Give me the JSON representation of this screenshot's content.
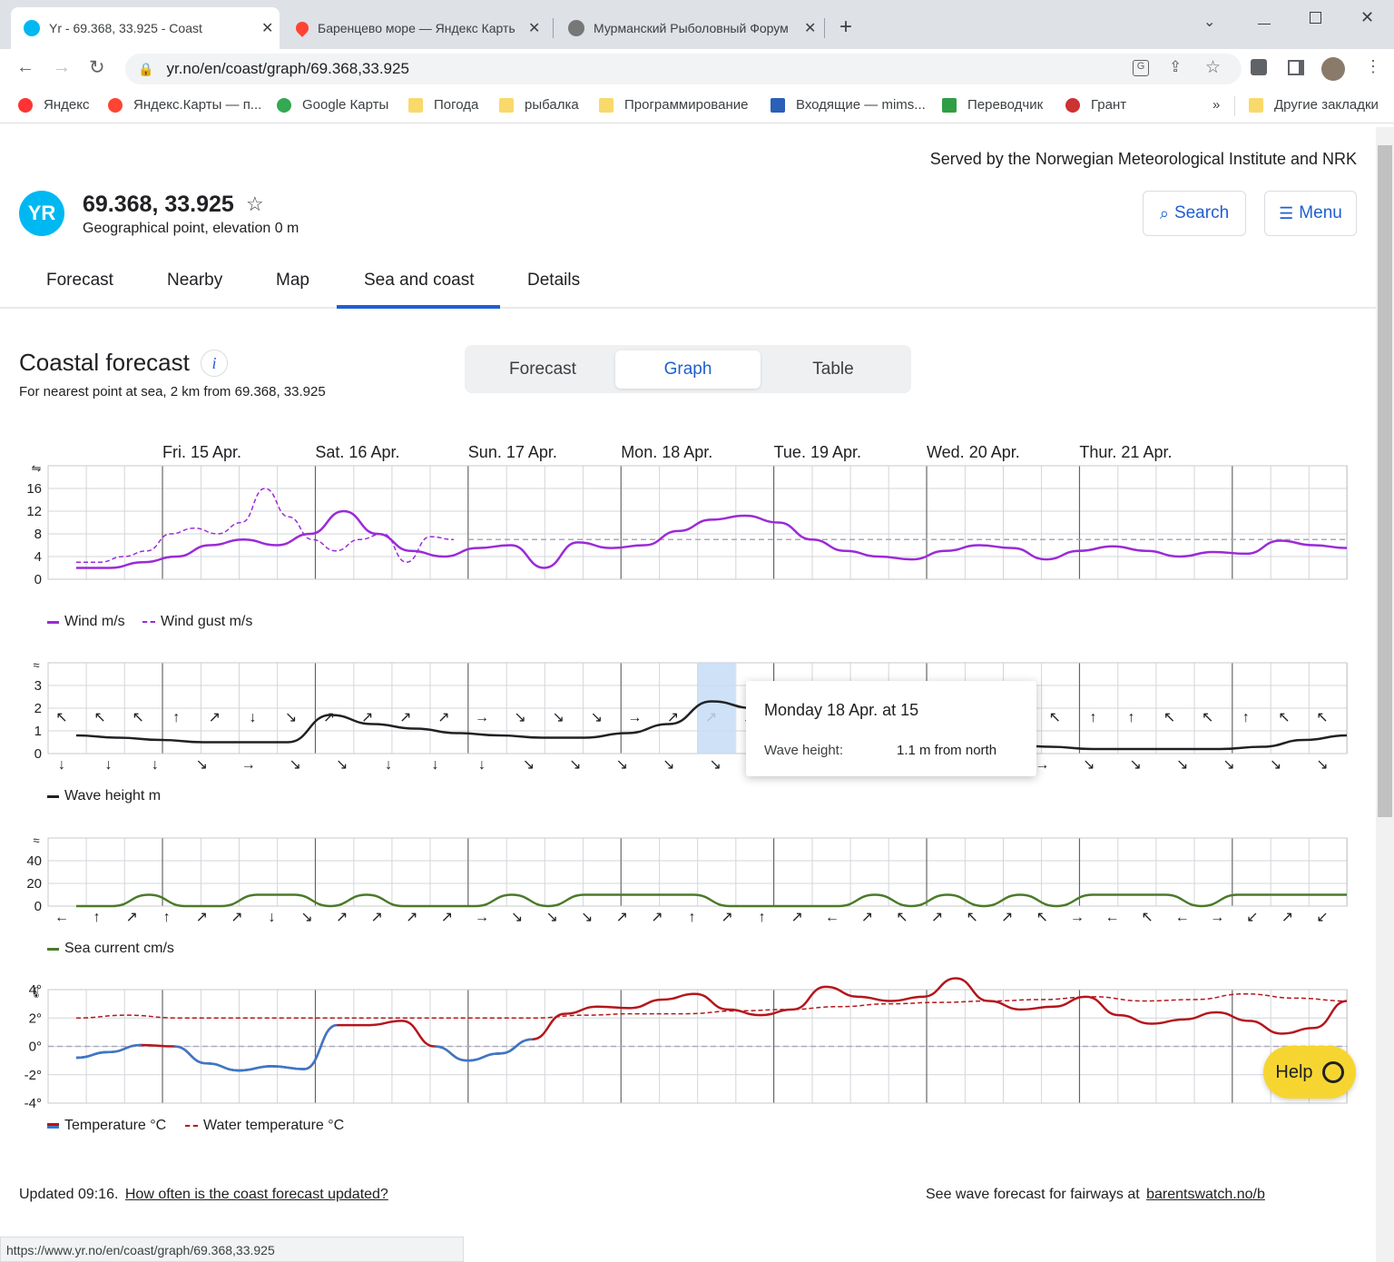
{
  "browser": {
    "tabs": [
      {
        "title": "Yr - 69.368, 33.925 - Coast",
        "fav_color": "#00b8f1"
      },
      {
        "title": "Баренцево море — Яндекс Карты",
        "fav_color": "#f43"
      },
      {
        "title": "Мурманский Рыболовный Форум",
        "fav_color": "#777"
      }
    ],
    "new_tab": "+",
    "url": "yr.no/en/coast/graph/69.368,33.925",
    "bookmarks": [
      "Яндекс",
      "Яндекс.Карты — п...",
      "Google Карты",
      "Погода",
      "рыбалка",
      "Программирование",
      "Входящие — mims...",
      "Переводчик",
      "Грант"
    ],
    "bookmarks_more": "»",
    "other_bookmarks": "Другие закладки",
    "status_url": "https://www.yr.no/en/coast/graph/69.368,33.925"
  },
  "header": {
    "served_by": "Served by the Norwegian Meteorological Institute and NRK",
    "logo": "YR",
    "location": "69.368, 33.925",
    "subtitle": "Geographical point, elevation 0 m",
    "search": "Search",
    "menu": "Menu"
  },
  "nav": {
    "tabs": [
      "Forecast",
      "Nearby",
      "Map",
      "Sea and coast",
      "Details"
    ],
    "active": "Sea and coast"
  },
  "coastal": {
    "title": "Coastal forecast",
    "info": "i",
    "subtitle": "For nearest point at sea, 2 km from 69.368, 33.925",
    "views": [
      "Forecast",
      "Graph",
      "Table"
    ],
    "active_view": "Graph"
  },
  "days": [
    "Fri. 15 Apr.",
    "Sat. 16 Apr.",
    "Sun. 17 Apr.",
    "Mon. 18 Apr.",
    "Tue. 19 Apr.",
    "Wed. 20 Apr.",
    "Thur. 21 Apr."
  ],
  "legends": {
    "wind": "Wind m/s",
    "gust": "Wind gust m/s",
    "wave": "Wave height m",
    "current": "Sea current cm/s",
    "temp": "Temperature °C",
    "water": "Water temperature °C"
  },
  "tooltip": {
    "title": "Monday 18 Apr. at 15",
    "label": "Wave height:",
    "value": "1.1 m from north"
  },
  "footer": {
    "updated": "Updated 09:16.",
    "updated_link": "How often is the coast forecast updated?",
    "wave_text": "See wave forecast for fairways at",
    "wave_link": "barentswatch.no/b"
  },
  "help": "Help",
  "colors": {
    "wind": "#9b2ad8",
    "wave": "#202124",
    "current": "#4a7a2a",
    "temp_warm": "#b4161b",
    "temp_cold": "#3a78c9",
    "accent": "#1f5fcf"
  },
  "chart_data": [
    {
      "type": "line",
      "x": [
        0,
        6,
        12,
        18,
        24,
        30,
        36,
        42,
        48,
        54,
        60,
        66,
        72,
        84,
        96,
        108,
        120,
        132,
        144,
        156,
        168,
        180,
        192,
        204,
        216,
        228,
        240,
        252,
        264,
        276,
        288,
        300,
        312,
        324,
        336,
        348,
        360,
        372,
        384
      ],
      "series": [
        {
          "name": "Wind m/s",
          "values": [
            2,
            2,
            3,
            4,
            6,
            7,
            6,
            8,
            12,
            8,
            5,
            4,
            5.5,
            6,
            2,
            6.5,
            5.5,
            6,
            8.5,
            10.5,
            11.2,
            10,
            7,
            5,
            4,
            3.5,
            5,
            6,
            5.5,
            3.5,
            5,
            5.8,
            5,
            4,
            4.8,
            4.5,
            6.8,
            6,
            5.5
          ]
        },
        {
          "name": "Wind gust m/s",
          "values": [
            3,
            3,
            4,
            5,
            8,
            9,
            8,
            10,
            16,
            11,
            7,
            5,
            7,
            8,
            3,
            7.5,
            7
          ]
        }
      ],
      "ylim": [
        0,
        16
      ],
      "yticks": [
        0,
        4,
        8,
        12,
        16
      ],
      "reference_line": 7,
      "wind_arrows": [
        "↖",
        "↖",
        "↖",
        "↑",
        "↗",
        "↓",
        "↘",
        "↗",
        "↗",
        "↗",
        "↗",
        "→",
        "↘",
        "↘",
        "↘",
        "→",
        "↗",
        "↗",
        "↗",
        "↗",
        "↗",
        "→",
        "↗",
        "↗",
        "↗",
        "↖",
        "↖",
        "↑",
        "↑",
        "↖",
        "↖",
        "↑",
        "↖",
        "↖"
      ]
    },
    {
      "type": "line",
      "series": [
        {
          "name": "Wave height m",
          "values": [
            0.8,
            0.7,
            0.6,
            0.5,
            0.5,
            0.5,
            1.7,
            1.3,
            1.1,
            0.9,
            0.8,
            0.7,
            0.7,
            0.9,
            1.3,
            2.3,
            2,
            1.8,
            1.4,
            1.1,
            1.0,
            0.6,
            0.4,
            0.3,
            0.2,
            0.2,
            0.2,
            0.2,
            0.3,
            0.6,
            0.8
          ]
        }
      ],
      "ylim": [
        0,
        3
      ],
      "yticks": [
        0,
        1,
        2,
        3
      ],
      "highlight_time": "Monday 18 Apr. at 15",
      "direction_arrows": [
        "↓",
        "↓",
        "↓",
        "↘",
        "→",
        "↘",
        "↘",
        "↓",
        "↓",
        "↓",
        "↘",
        "↘",
        "↘",
        "↘",
        "↘",
        "↘",
        "↓",
        "↓",
        "↓",
        "↘",
        "↗",
        "→",
        "↘",
        "↘",
        "↘",
        "↘",
        "↘",
        "↘"
      ]
    },
    {
      "type": "line",
      "series": [
        {
          "name": "Sea current cm/s",
          "values": [
            0,
            0,
            10,
            0,
            0,
            10,
            10,
            0,
            10,
            0,
            0,
            0,
            10,
            0,
            10,
            10,
            10,
            10,
            0,
            0,
            0,
            0,
            10,
            0,
            10,
            0,
            10,
            0,
            10,
            10,
            10,
            0,
            10,
            10,
            10,
            10
          ]
        }
      ],
      "ylim": [
        0,
        40
      ],
      "yticks": [
        0,
        20,
        40
      ],
      "direction_arrows": [
        "←",
        "↑",
        "↗",
        "↑",
        "↗",
        "↗",
        "↓",
        "↘",
        "↗",
        "↗",
        "↗",
        "↗",
        "→",
        "↘",
        "↘",
        "↘",
        "↗",
        "↗",
        "↑",
        "↗",
        "↑",
        "↗",
        "←",
        "↗",
        "↖",
        "↗",
        "↖",
        "↗",
        "↖",
        "→",
        "←",
        "↖",
        "←",
        "→",
        "↙",
        "↗",
        "↙"
      ]
    },
    {
      "type": "line",
      "series": [
        {
          "name": "Temperature °C",
          "values": [
            -0.8,
            -0.4,
            0.1,
            0,
            -1.2,
            -1.7,
            -1.4,
            -1.6,
            1.5,
            1.5,
            1.8,
            0,
            -1,
            -0.5,
            0.5,
            2.3,
            2.8,
            2.7,
            3.3,
            3.7,
            2.6,
            2.2,
            2.6,
            4.2,
            3.5,
            3.2,
            3.5,
            4.8,
            3.2,
            2.6,
            2.8,
            3.5,
            2.2,
            1.6,
            1.9,
            2.4,
            1.8,
            0.9,
            1.3,
            3.2
          ]
        },
        {
          "name": "Water temperature °C",
          "values": [
            2,
            2.2,
            2,
            2,
            2,
            2,
            2,
            2,
            2,
            2,
            2.2,
            2.3,
            2.3,
            2.5,
            2.6,
            2.8,
            3,
            3.1,
            3.2,
            3.3,
            3.5,
            3.2,
            3.3,
            3.7,
            3.4,
            3.2
          ]
        }
      ],
      "ylim": [
        -4,
        4
      ],
      "yticks": [
        "4°",
        "2°",
        "0°",
        "-2°",
        "-4°"
      ]
    }
  ]
}
